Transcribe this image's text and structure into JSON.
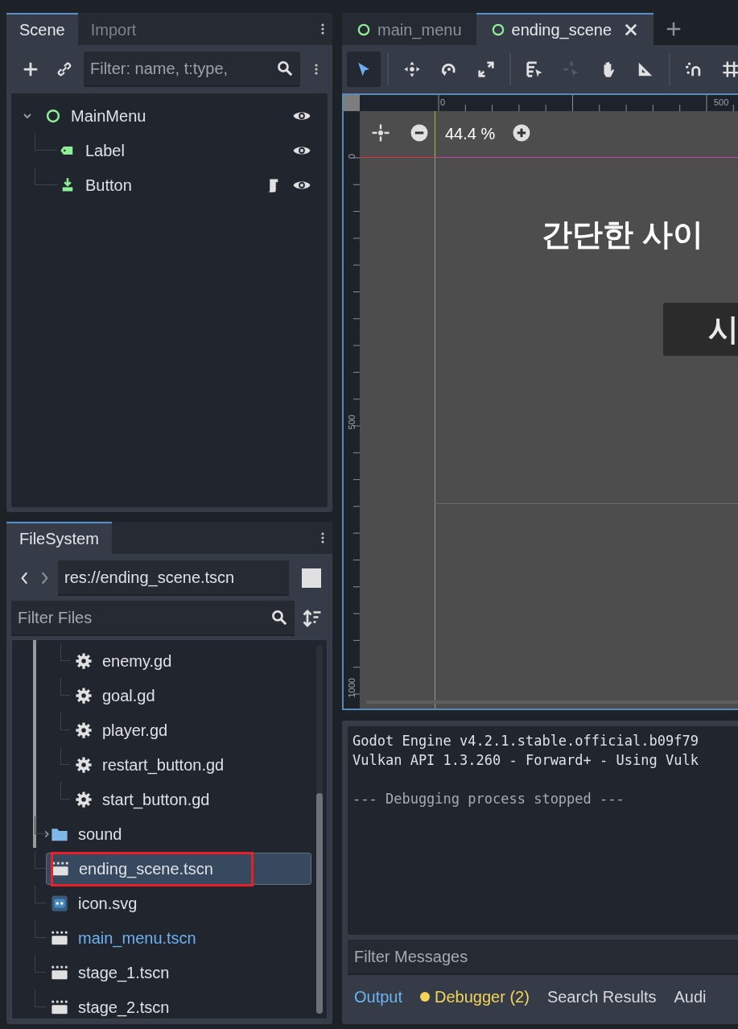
{
  "scene_dock": {
    "tabs": [
      {
        "label": "Scene",
        "selected": true
      },
      {
        "label": "Import",
        "selected": false
      }
    ],
    "filter": {
      "placeholder": "Filter: name, t:type,"
    },
    "nodes": [
      {
        "name": "MainMenu",
        "kind": "control",
        "visible": true,
        "expanded": true,
        "children": [
          {
            "name": "Label",
            "kind": "label",
            "visible": true,
            "has_script": false
          },
          {
            "name": "Button",
            "kind": "button",
            "visible": true,
            "has_script": true
          }
        ]
      }
    ]
  },
  "filesystem_dock": {
    "tabs": [
      {
        "label": "FileSystem",
        "selected": true
      }
    ],
    "path": "res://ending_scene.tscn",
    "filter": {
      "placeholder": "Filter Files"
    },
    "files": [
      {
        "children": [
          {
            "name": "enemy.gd",
            "kind": "script"
          },
          {
            "name": "goal.gd",
            "kind": "script"
          },
          {
            "name": "player.gd",
            "kind": "script"
          },
          {
            "name": "restart_button.gd",
            "kind": "script"
          },
          {
            "name": "start_button.gd",
            "kind": "script"
          }
        ]
      },
      {
        "name": "sound",
        "kind": "folder",
        "expanded": false
      },
      {
        "name": "ending_scene.tscn",
        "kind": "scene",
        "selected": true,
        "marked": true
      },
      {
        "name": "icon.svg",
        "kind": "image",
        "selected": false
      },
      {
        "name": "main_menu.tscn",
        "kind": "scene",
        "selected": false,
        "open": true
      },
      {
        "name": "stage_1.tscn",
        "kind": "scene",
        "selected": false
      },
      {
        "name": "stage_2.tscn",
        "kind": "scene",
        "selected": false
      }
    ]
  },
  "editor_tabs": [
    {
      "label": "main_menu",
      "selected": false
    },
    {
      "label": "ending_scene",
      "selected": true
    }
  ],
  "tools": [
    {
      "selected": true
    },
    {
      "selected": false
    },
    {
      "selected": false
    },
    {
      "selected": false
    },
    {
      "selected": false
    },
    {
      "selected": false,
      "disabled": true
    },
    {
      "selected": false
    },
    {
      "selected": false
    },
    {
      "selected": false
    },
    {
      "selected": false
    }
  ],
  "viewport": {
    "zoom": "44.4 %",
    "top_ruler": [
      "0",
      "500"
    ],
    "left_ruler": [
      "0",
      "500",
      "1000"
    ],
    "title": "간단한 사이",
    "button": "시"
  },
  "output": {
    "lines": [
      {
        "text": "Godot Engine v4.2.1.stable.official.b09f79",
        "kind": "info"
      },
      {
        "text": "Vulkan API 1.3.260 - Forward+ - Using Vulk",
        "kind": "info"
      },
      {
        "text": "--- Debugging process stopped ---",
        "kind": "muted"
      }
    ],
    "filter": {
      "placeholder": "Filter Messages"
    },
    "tabs": [
      {
        "label": "Output",
        "selected": true
      },
      {
        "label": "Debugger (2)",
        "selected": false,
        "warning": true
      },
      {
        "label": "Search Results",
        "selected": false
      },
      {
        "label": "Audi",
        "selected": false
      }
    ]
  }
}
